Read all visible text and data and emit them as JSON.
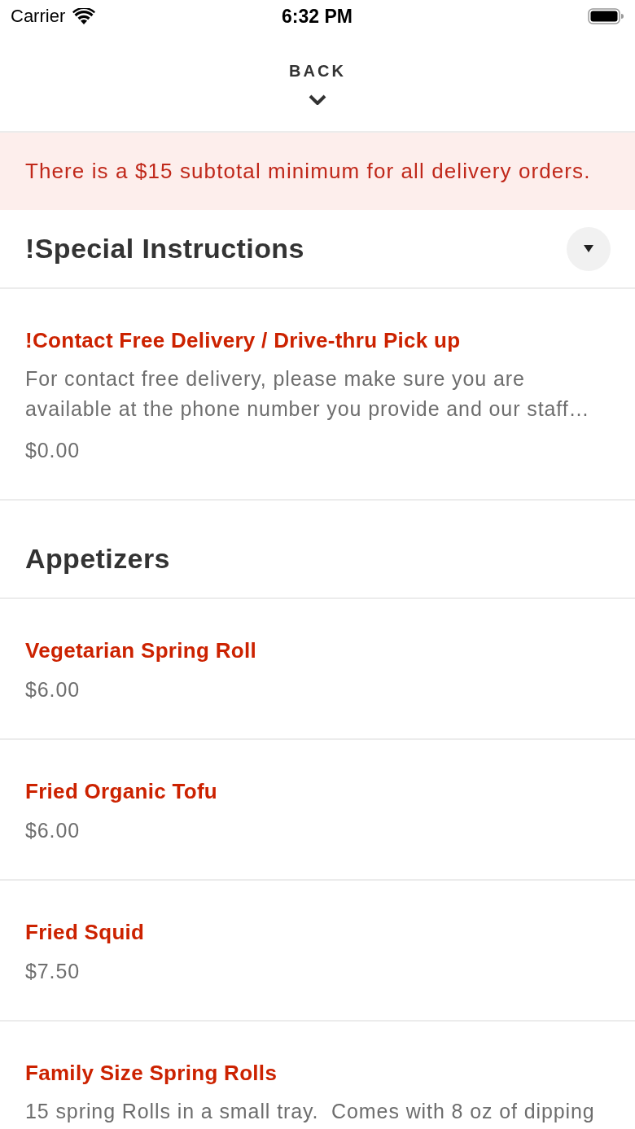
{
  "status_bar": {
    "carrier": "Carrier",
    "time": "6:32 PM"
  },
  "nav": {
    "back_label": "BACK"
  },
  "notice": "There is a $15 subtotal minimum for all delivery orders.",
  "sections": [
    {
      "title": "!Special Instructions",
      "toggle": true,
      "items": [
        {
          "name": "!Contact Free Delivery / Drive-thru Pick up",
          "description": "For contact free delivery, please make sure you are available at the phone number you provide and our staff…",
          "price": "$0.00"
        }
      ]
    },
    {
      "title": "Appetizers",
      "toggle": false,
      "items": [
        {
          "name": "Vegetarian Spring Roll",
          "price": "$6.00"
        },
        {
          "name": "Fried Organic Tofu",
          "price": "$6.00"
        },
        {
          "name": "Fried Squid",
          "price": "$7.50"
        },
        {
          "name": "Family Size Spring Rolls",
          "description": "15 spring Rolls in a small tray.  Comes with 8 oz of dipping"
        }
      ]
    }
  ]
}
